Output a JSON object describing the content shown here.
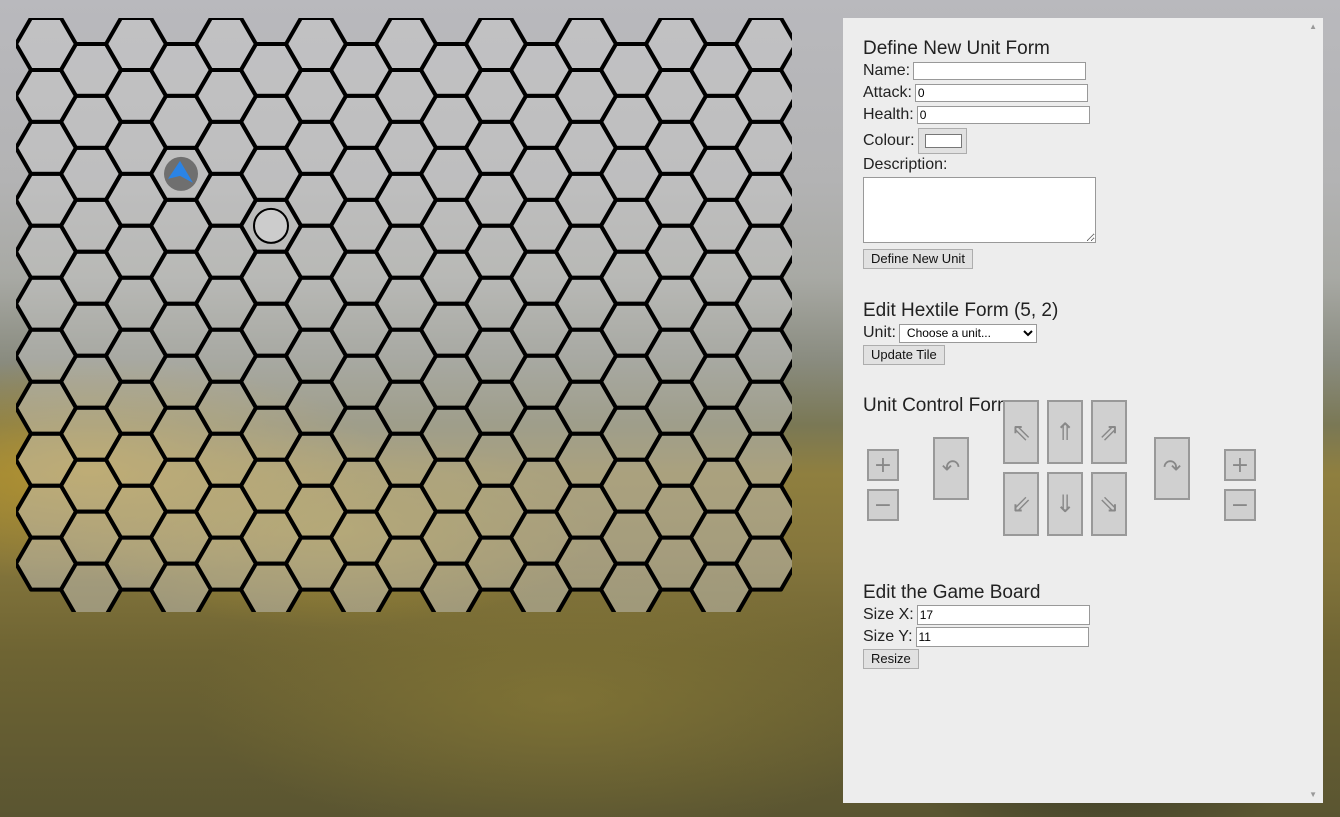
{
  "board": {
    "size_x": 17,
    "size_y": 11,
    "units": [
      {
        "col": 3,
        "row": 2,
        "kind": "arrow",
        "color": "#2b84e6"
      },
      {
        "col": 5,
        "row": 3,
        "kind": "circle",
        "color": "#cccccc"
      }
    ]
  },
  "define_unit_form": {
    "title": "Define New Unit Form",
    "name_label": "Name:",
    "name_value": "",
    "attack_label": "Attack:",
    "attack_value": "0",
    "health_label": "Health:",
    "health_value": "0",
    "colour_label": "Colour:",
    "colour_value": "#ffffff",
    "description_label": "Description:",
    "description_value": "",
    "submit_label": "Define New Unit"
  },
  "edit_hextile_form": {
    "title": "Edit Hextile Form (5, 2)",
    "unit_label": "Unit:",
    "unit_selected": "Choose a unit...",
    "submit_label": "Update Tile"
  },
  "unit_control_form": {
    "title": "Unit Control Form",
    "buttons": {
      "zoom_in_left": "+",
      "zoom_out_left": "−",
      "rotate_left": "↶",
      "move_up_left": "⇖",
      "move_up": "⇑",
      "move_up_right": "⇗",
      "move_down_left": "⇙",
      "move_down": "⇓",
      "move_down_right": "⇘",
      "rotate_right": "↷",
      "zoom_in_right": "+",
      "zoom_out_right": "−"
    }
  },
  "edit_board_form": {
    "title": "Edit the Game Board",
    "size_x_label": "Size X:",
    "size_x_value": "17",
    "size_y_label": "Size Y:",
    "size_y_value": "11",
    "submit_label": "Resize"
  },
  "icons": {
    "scroll_up": "scroll-up-arrow-icon",
    "scroll_down": "scroll-down-arrow-icon",
    "unit_arrow": "blue-arrow-unit-icon"
  }
}
